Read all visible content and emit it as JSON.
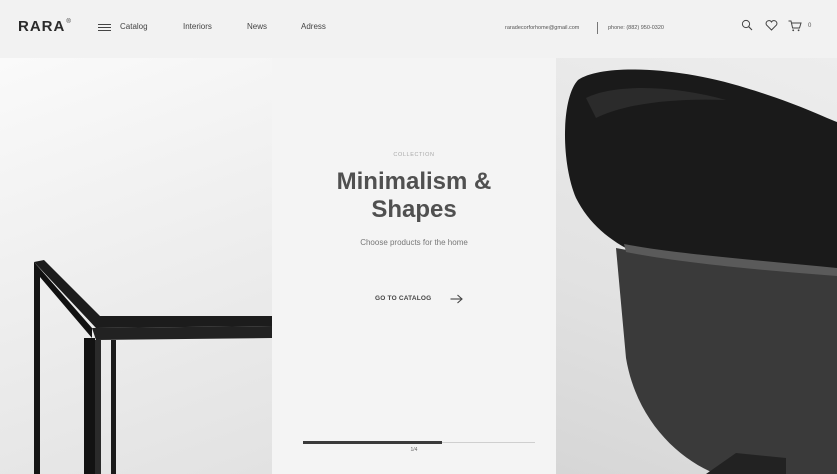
{
  "header": {
    "logo": "RARA",
    "logo_mark": "®",
    "nav": {
      "catalog": "Catalog",
      "interiors": "Interiors",
      "news": "News",
      "adress": "Adress"
    },
    "email": "raradecorforhome@gmail.com",
    "phone": "phone: (882) 950-0320",
    "cart_count": "0",
    "icons": [
      "menu-icon",
      "search-icon",
      "heart-icon",
      "cart-icon"
    ]
  },
  "hero": {
    "eyebrow": "COLLECTION",
    "title_line1": "Minimalism &",
    "title_line2": "Shapes",
    "subtitle": "Choose products for the home",
    "cta": "GO TO CATALOG",
    "slide_counter": "1/4",
    "progress": 0.6
  },
  "colors": {
    "background": "#f2f2f2",
    "title": "#505050",
    "progress": "#3a3a3a"
  }
}
